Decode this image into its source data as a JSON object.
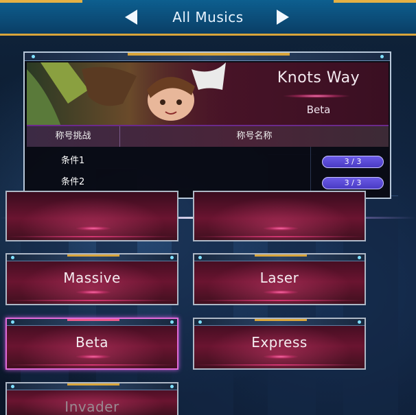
{
  "header": {
    "title": "All Musics",
    "prev_icon": "arrow-left-icon",
    "next_icon": "arrow-right-icon"
  },
  "song": {
    "title": "Knots Way",
    "difficulty": "Beta"
  },
  "challenge_table": {
    "col_challenge": "称号挑战",
    "col_name": "称号名称",
    "rows": [
      {
        "condition": "条件1",
        "progress": "3 / 3"
      },
      {
        "condition": "条件2",
        "progress": "3 / 3"
      }
    ]
  },
  "difficulties": [
    {
      "label": "",
      "state": "partial"
    },
    {
      "label": "",
      "state": "partial"
    },
    {
      "label": "Massive",
      "state": "normal"
    },
    {
      "label": "Laser",
      "state": "normal"
    },
    {
      "label": "Beta",
      "state": "selected"
    },
    {
      "label": "Express",
      "state": "normal"
    },
    {
      "label": "Invader",
      "state": "dim"
    }
  ],
  "colors": {
    "accent_gold": "#d9a53a",
    "header_blue": "#0d5f8f",
    "card_magenta": "#6a1430",
    "progress_purple": "#5a4ad6",
    "selected_border": "#e06ad8"
  }
}
